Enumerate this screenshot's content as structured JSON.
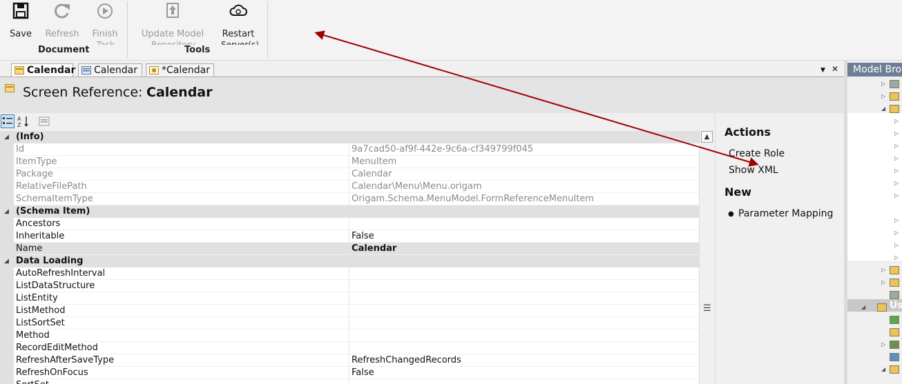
{
  "ribbon": {
    "buttons": [
      {
        "label": "Save",
        "icon": "save-icon",
        "enabled": true
      },
      {
        "label": "Refresh",
        "icon": "refresh-icon",
        "enabled": false
      },
      {
        "label": "Finish",
        "sub": "Task",
        "icon": "play-icon",
        "enabled": false
      },
      {
        "label": "Update Model",
        "sub": "Repository",
        "icon": "upload-icon",
        "enabled": false
      },
      {
        "label": "Restart",
        "sub": "Server(s)",
        "icon": "cloud-refresh-icon",
        "enabled": true
      }
    ],
    "groups": [
      "Document",
      "Tools"
    ]
  },
  "tabs": [
    {
      "label": "Calendar",
      "active": true
    },
    {
      "label": "Calendar",
      "active": false
    },
    {
      "label": "*Calendar",
      "active": false
    }
  ],
  "tab_controls": {
    "dropdown": "▼",
    "close": "✕"
  },
  "header": {
    "label": "Screen Reference:",
    "name": "Calendar"
  },
  "grid": {
    "categories": [
      {
        "label": "(Info)",
        "rows": [
          {
            "name": "Id",
            "value": "9a7cad50-af9f-442e-9c6a-cf349799f045",
            "readonly": true
          },
          {
            "name": "ItemType",
            "value": "MenuItem",
            "readonly": true
          },
          {
            "name": "Package",
            "value": "Calendar",
            "readonly": true
          },
          {
            "name": "RelativeFilePath",
            "value": "Calendar\\Menu\\Menu.origam",
            "readonly": true
          },
          {
            "name": "SchemaItemType",
            "value": "Origam.Schema.MenuModel.FormReferenceMenuItem",
            "readonly": true
          }
        ]
      },
      {
        "label": "(Schema Item)",
        "rows": [
          {
            "name": "Ancestors",
            "value": ""
          },
          {
            "name": "Inheritable",
            "value": "False"
          },
          {
            "name": "Name",
            "value": "Calendar",
            "selected": true
          }
        ]
      },
      {
        "label": "Data Loading",
        "rows": [
          {
            "name": "AutoRefreshInterval",
            "value": ""
          },
          {
            "name": "ListDataStructure",
            "value": ""
          },
          {
            "name": "ListEntity",
            "value": ""
          },
          {
            "name": "ListMethod",
            "value": ""
          },
          {
            "name": "ListSortSet",
            "value": ""
          },
          {
            "name": "Method",
            "value": ""
          },
          {
            "name": "RecordEditMethod",
            "value": ""
          },
          {
            "name": "RefreshAfterSaveType",
            "value": "RefreshChangedRecords"
          },
          {
            "name": "RefreshOnFocus",
            "value": "False"
          },
          {
            "name": "SortSet",
            "value": ""
          }
        ]
      }
    ]
  },
  "actions": {
    "title": "Actions",
    "items": [
      "Create Role",
      "Show XML"
    ],
    "new_title": "New",
    "new_items": [
      "Parameter Mapping"
    ]
  },
  "model_browser": {
    "title": "Model Browser",
    "selected_label": "Us"
  },
  "colors": {
    "arrow": "#a00000",
    "browser_title": "#6d7f95",
    "category_bg": "#e0e0e0"
  }
}
